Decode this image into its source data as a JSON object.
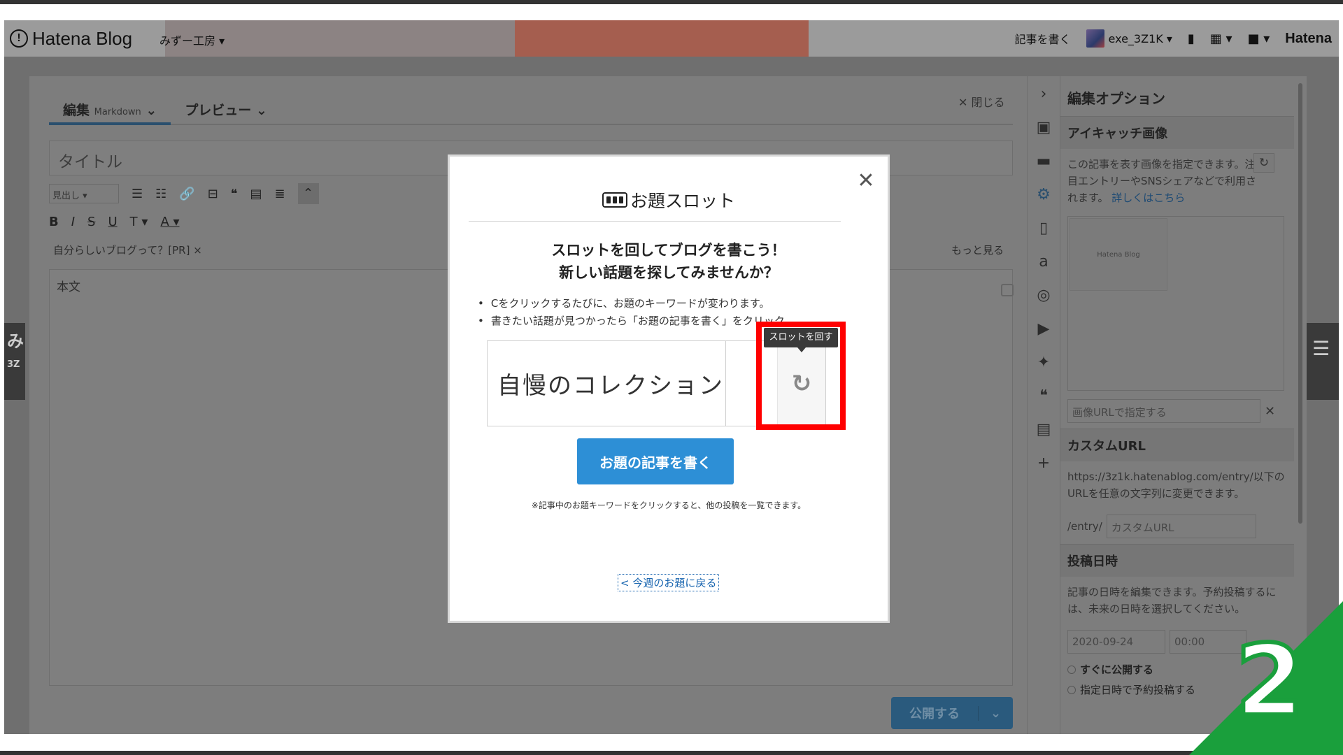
{
  "header": {
    "logo_text": "Hatena Blog",
    "blog_name": "みずー工房 ▾",
    "write_post": "記事を書く",
    "username": "exe_3Z1K ▾",
    "bookmark_icon": "bookmark-icon",
    "apps_icon": "grid-icon",
    "notifications_icon": "chat-icon",
    "hatena_link": "Hatena"
  },
  "side_band": {
    "left_text": "み\n3Z",
    "right_text": "☰"
  },
  "editor": {
    "tabs": [
      {
        "label": "編集",
        "sub": "Markdown",
        "active": true
      },
      {
        "label": "プレビュー",
        "sub": "",
        "active": false
      }
    ],
    "close_label": "✕ 閉じる",
    "title_placeholder": "タイトル",
    "heading_select": "見出し",
    "toolbar_row1": [
      "☰",
      "☷",
      "🔗",
      "⊟",
      "❝",
      "▤",
      "≣"
    ],
    "toolbar_row2": [
      "B",
      "I",
      "S",
      "U",
      "T ▾",
      "A ▾"
    ],
    "pr_text": "自分らしいブログって？[PR] ×",
    "more_label": "もっと見る",
    "body_placeholder": "本文",
    "publish_label": "公開する",
    "publish_caret": "⌄"
  },
  "options": {
    "panel_title": "編集オプション",
    "eyecatch_title": "アイキャッチ画像",
    "eyecatch_desc": "この記事を表す画像を指定できます。注目エントリーやSNSシェアなどで利用されます。",
    "eyecatch_link": "詳しくはこちら",
    "thumb_label": "Hatena Blog",
    "image_url_placeholder": "画像URLで指定する",
    "custom_url_title": "カスタムURL",
    "custom_url_desc": "https://3z1k.hatenablog.com/entry/以下のURLを任意の文字列に変更できます。",
    "entry_prefix": "/entry/",
    "custom_url_placeholder": "カスタムURL",
    "datetime_title": "投稿日時",
    "datetime_desc": "記事の日時を編集できます。予約投稿するには、未来の日時を選択してください。",
    "date_value": "2020-09-24",
    "time_value": "00:00",
    "radio_now": "すぐに公開する",
    "radio_scheduled": "指定日時で予約投稿する"
  },
  "dialog": {
    "title": "お題スロット",
    "heading_line1": "スロットを回してブログを書こう！",
    "heading_line2": "新しい話題を探してみませんか？",
    "bullet1": "Cをクリックするたびに、お題のキーワードが変わります。",
    "bullet2": "書きたい話題が見つかったら「お題の記事を書く」をクリック",
    "topic": "自慢のコレクション",
    "spin_tooltip": "スロットを回す",
    "spin_icon": "refresh-icon",
    "write_button": "お題の記事を書く",
    "note": "※記事中のお題キーワードをクリックすると、他の投稿を一覧できます。",
    "back_link": "< 今週のお題に戻る",
    "close_glyph": "✕"
  },
  "step_badge": {
    "number": "2",
    "color": "#1a9f3c"
  }
}
